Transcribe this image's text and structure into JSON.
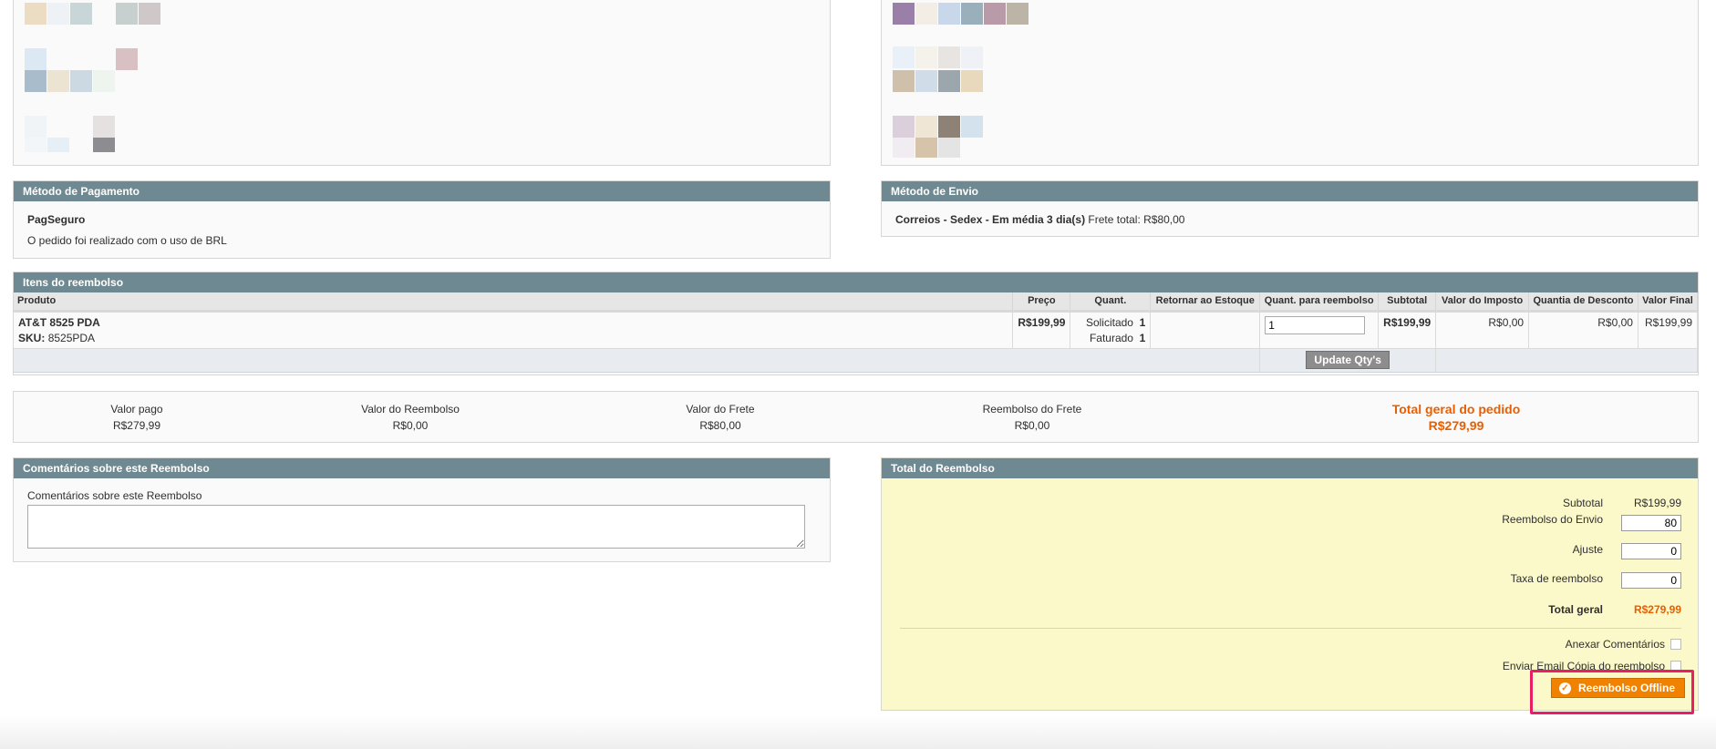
{
  "payment": {
    "title": "Método de Pagamento",
    "method": "PagSeguro",
    "note": "O pedido foi realizado com o uso de BRL"
  },
  "shipping": {
    "title": "Método de Envio",
    "method": "Correios - Sedex - Em média 3 dia(s)",
    "total": "Frete total: R$80,00"
  },
  "items": {
    "title": "Itens do reembolso",
    "headers": [
      "Produto",
      "Preço",
      "Quant.",
      "Retornar ao Estoque",
      "Quant. para reembolso",
      "Subtotal",
      "Valor do Imposto",
      "Quantia de Desconto",
      "Valor Final"
    ],
    "row": {
      "name": "AT&T 8525 PDA",
      "sku_label": "SKU:",
      "sku": "8525PDA",
      "price": "R$199,99",
      "qty_ordered_label": "Solicitado",
      "qty_ordered": "1",
      "qty_invoiced_label": "Faturado",
      "qty_invoiced": "1",
      "refund_qty": "1",
      "subtotal": "R$199,99",
      "tax": "R$0,00",
      "discount": "R$0,00",
      "final": "R$199,99"
    },
    "update_button": "Update Qty's"
  },
  "summary": {
    "paid_label": "Valor pago",
    "paid": "R$279,99",
    "refunded_label": "Valor do Reembolso",
    "refunded": "R$0,00",
    "shipping_label": "Valor do Frete",
    "shipping": "R$80,00",
    "shipping_refund_label": "Reembolso do Frete",
    "shipping_refund": "R$0,00",
    "grand_label": "Total geral do pedido",
    "grand": "R$279,99"
  },
  "comments": {
    "title": "Comentários sobre este Reembolso",
    "label": "Comentários sobre este Reembolso",
    "value": ""
  },
  "totals": {
    "title": "Total do Reembolso",
    "subtotal_label": "Subtotal",
    "subtotal": "R$199,99",
    "shipping_label": "Reembolso do Envio",
    "shipping": "80",
    "adjust_label": "Ajuste",
    "adjust": "0",
    "fee_label": "Taxa de reembolso",
    "fee": "0",
    "grand_label": "Total geral",
    "grand": "R$279,99",
    "append_comments_label": "Anexar Comentários",
    "email_copy_label": "Enviar Email Cópia do reembolso",
    "offline_button": "Reembolso Offline"
  },
  "colors": {
    "section_header": "#6f8992",
    "accent_orange": "#f18200",
    "highlight": "#e91e63",
    "totals_bg": "#fbf9c9"
  }
}
